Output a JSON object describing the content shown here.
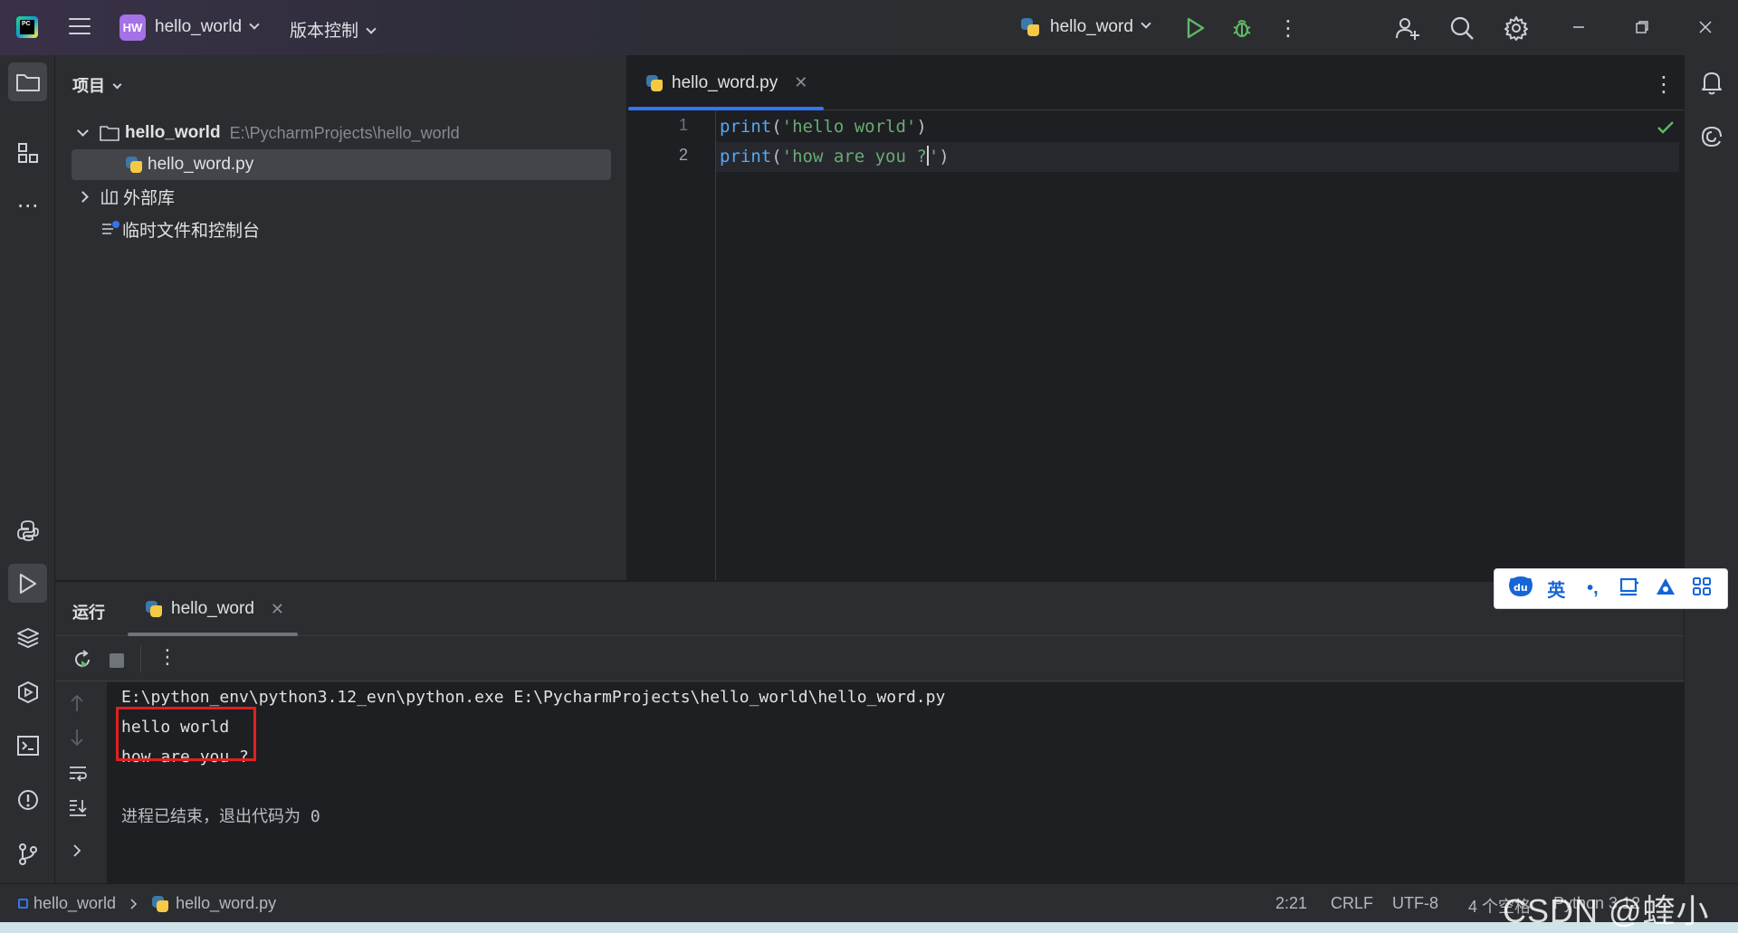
{
  "titlebar": {
    "app_logo_text": "PC",
    "project_badge": "HW",
    "project_name": "hello_world",
    "vcs_menu": "版本控制",
    "run_config": "hello_word"
  },
  "project_panel": {
    "title": "项目",
    "root": {
      "name": "hello_world",
      "path": "E:\\PycharmProjects\\hello_world"
    },
    "file": "hello_word.py",
    "external_libs": "外部库",
    "scratches": "临时文件和控制台"
  },
  "editor": {
    "tab": "hello_word.py",
    "lines": [
      {
        "num": "1",
        "fn": "print",
        "open": "(",
        "str": "'hello world'",
        "close": ")"
      },
      {
        "num": "2",
        "fn": "print",
        "open": "(",
        "str_before_caret": "'how are you ?",
        "str_after_caret": "'",
        "close": ")"
      }
    ]
  },
  "run_panel": {
    "title": "运行",
    "tab": "hello_word",
    "console": {
      "command": "E:\\python_env\\python3.12_evn\\python.exe E:\\PycharmProjects\\hello_world\\hello_word.py",
      "output1": "hello world",
      "output2": "how are you ?",
      "exit": "进程已结束，退出代码为 0"
    }
  },
  "statusbar": {
    "crumb_project": "hello_world",
    "crumb_file": "hello_word.py",
    "position": "2:21",
    "line_sep": "CRLF",
    "encoding": "UTF-8",
    "indent": "4 个空格",
    "interpreter": "Python 3.12"
  },
  "ime": {
    "lang": "英",
    "punct": "•,"
  },
  "watermark": "CSDN @蝰小蜂",
  "colors": {
    "accent": "#3574f0",
    "run_green": "#5fb865",
    "highlight_red": "#e02020",
    "badge_purple": "#a571e6"
  }
}
